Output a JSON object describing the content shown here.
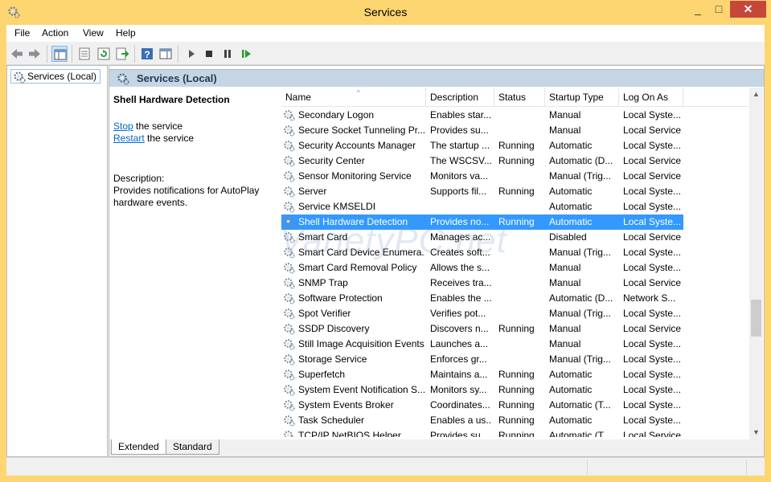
{
  "window": {
    "title": "Services",
    "icon": "services-gear-icon",
    "minimize_icon": "_",
    "maximize_icon": "□",
    "close_icon": "✕"
  },
  "menu": [
    "File",
    "Action",
    "View",
    "Help"
  ],
  "toolbar": {
    "icons": [
      "back-arrow-icon",
      "forward-arrow-icon",
      "show-hide-console-tree-icon",
      "properties-icon",
      "refresh-icon",
      "export-list-icon",
      "help-icon",
      "show-hide-action-pane-icon",
      "start-service-icon",
      "stop-service-icon",
      "pause-service-icon",
      "resume-service-icon"
    ]
  },
  "tree": {
    "root": "Services (Local)"
  },
  "header": {
    "title": "Services (Local)"
  },
  "detail": {
    "service_name": "Shell Hardware Detection",
    "stop_link": "Stop",
    "stop_rest": " the service",
    "restart_link": "Restart",
    "restart_rest": " the service",
    "description_label": "Description:",
    "description": "Provides notifications for AutoPlay hardware events."
  },
  "columns": [
    "Name",
    "Description",
    "Status",
    "Startup Type",
    "Log On As"
  ],
  "sort_indicator": "^",
  "rows": [
    {
      "name": "Secondary Logon",
      "description": "Enables star...",
      "status": "",
      "startup": "Manual",
      "logon": "Local Syste..."
    },
    {
      "name": "Secure Socket Tunneling Pr...",
      "description": "Provides su...",
      "status": "",
      "startup": "Manual",
      "logon": "Local Service"
    },
    {
      "name": "Security Accounts Manager",
      "description": "The startup ...",
      "status": "Running",
      "startup": "Automatic",
      "logon": "Local Syste..."
    },
    {
      "name": "Security Center",
      "description": "The WSCSV...",
      "status": "Running",
      "startup": "Automatic (D...",
      "logon": "Local Service"
    },
    {
      "name": "Sensor Monitoring Service",
      "description": "Monitors va...",
      "status": "",
      "startup": "Manual (Trig...",
      "logon": "Local Service"
    },
    {
      "name": "Server",
      "description": "Supports fil...",
      "status": "Running",
      "startup": "Automatic",
      "logon": "Local Syste..."
    },
    {
      "name": "Service KMSELDI",
      "description": "",
      "status": "",
      "startup": "Automatic",
      "logon": "Local Syste..."
    },
    {
      "name": "Shell Hardware Detection",
      "description": "Provides no...",
      "status": "Running",
      "startup": "Automatic",
      "logon": "Local Syste...",
      "selected": true
    },
    {
      "name": "Smart Card",
      "description": "Manages ac...",
      "status": "",
      "startup": "Disabled",
      "logon": "Local Service"
    },
    {
      "name": "Smart Card Device Enumera...",
      "description": "Creates soft...",
      "status": "",
      "startup": "Manual (Trig...",
      "logon": "Local Syste..."
    },
    {
      "name": "Smart Card Removal Policy",
      "description": "Allows the s...",
      "status": "",
      "startup": "Manual",
      "logon": "Local Syste..."
    },
    {
      "name": "SNMP Trap",
      "description": "Receives tra...",
      "status": "",
      "startup": "Manual",
      "logon": "Local Service"
    },
    {
      "name": "Software Protection",
      "description": "Enables the ...",
      "status": "",
      "startup": "Automatic (D...",
      "logon": "Network S..."
    },
    {
      "name": "Spot Verifier",
      "description": "Verifies pot...",
      "status": "",
      "startup": "Manual (Trig...",
      "logon": "Local Syste..."
    },
    {
      "name": "SSDP Discovery",
      "description": "Discovers n...",
      "status": "Running",
      "startup": "Manual",
      "logon": "Local Service"
    },
    {
      "name": "Still Image Acquisition Events",
      "description": "Launches a...",
      "status": "",
      "startup": "Manual",
      "logon": "Local Syste..."
    },
    {
      "name": "Storage Service",
      "description": "Enforces gr...",
      "status": "",
      "startup": "Manual (Trig...",
      "logon": "Local Syste..."
    },
    {
      "name": "Superfetch",
      "description": "Maintains a...",
      "status": "Running",
      "startup": "Automatic",
      "logon": "Local Syste..."
    },
    {
      "name": "System Event Notification S...",
      "description": "Monitors sy...",
      "status": "Running",
      "startup": "Automatic",
      "logon": "Local Syste..."
    },
    {
      "name": "System Events Broker",
      "description": "Coordinates...",
      "status": "Running",
      "startup": "Automatic (T...",
      "logon": "Local Syste..."
    },
    {
      "name": "Task Scheduler",
      "description": "Enables a us...",
      "status": "Running",
      "startup": "Automatic",
      "logon": "Local Syste..."
    },
    {
      "name": "TCP/IP NetBIOS Helper",
      "description": "Provides su...",
      "status": "Running",
      "startup": "Automatic (T...",
      "logon": "Local Service"
    }
  ],
  "tabs": [
    "Extended",
    "Standard"
  ],
  "active_tab": "Extended",
  "watermark": "VarietyPC.net",
  "colors": {
    "title_bar": "#fdd672",
    "selection": "#3399ff",
    "close_button": "#c7463a",
    "header_band": "#c5d5e3",
    "link": "#0066cc"
  }
}
